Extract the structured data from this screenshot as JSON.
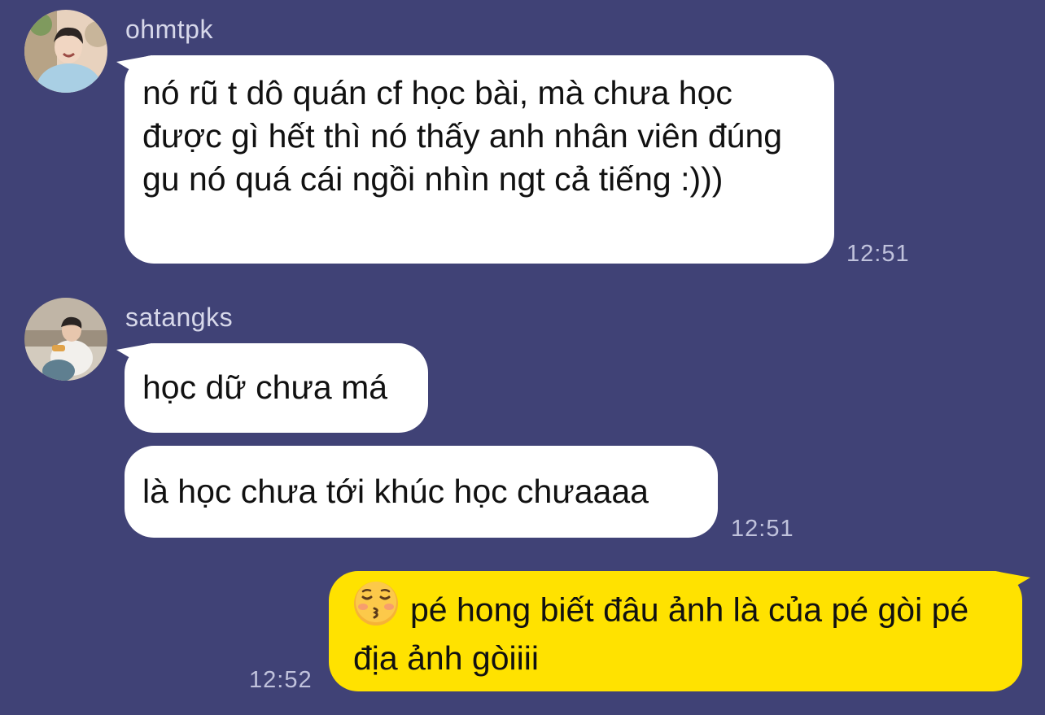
{
  "messages": [
    {
      "sender": "ohmtpk",
      "bubbles": [
        "nó rũ t dô quán cf học bài, mà chưa học được gì hết thì nó thấy anh nhân viên đúng gu nó quá cái ngồi nhìn ngt cả tiếng :)))"
      ],
      "time": "12:51"
    },
    {
      "sender": "satangks",
      "bubbles": [
        "học dữ chưa má",
        "là học chưa tới khúc học chưaaaa"
      ],
      "time": "12:51"
    },
    {
      "sender": "me",
      "emoji": "kissing-face-with-closed-eyes",
      "text": "pé hong biết đâu ảnh là của pé gòi pé địa ảnh gòiiii",
      "time": "12:52"
    }
  ],
  "colors": {
    "background": "#404276",
    "incoming_bubble": "#ffffff",
    "outgoing_bubble": "#ffe200",
    "timestamp": "#c0c2dc"
  }
}
